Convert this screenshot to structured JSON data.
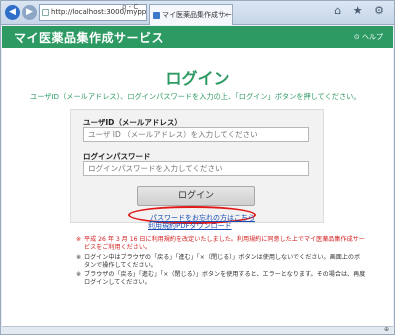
{
  "browser": {
    "address": "http://localhost:3000/myppe",
    "address_tools": "ρ - C",
    "tab_label": "マイ医薬品集作成サービ...",
    "tab_close": "×",
    "window_icons": "⌂ ★ ⚙"
  },
  "app": {
    "title": "マイ医薬品集作成サービス",
    "help": "⊙ ヘルプ"
  },
  "login": {
    "title": "ログイン",
    "instruction": "ユーザID（メールアドレス）、ログインパスワードを入力の上、「ログイン」ボタンを押してください。",
    "user_label": "ユーザID（メールアドレス）",
    "user_placeholder": "ユーザ ID （メールアドレス）を入力してください",
    "password_label": "ログインパスワード",
    "password_placeholder": "ログインパスワードを入力してください",
    "button": "ログイン",
    "forgot_link": "パスワードをお忘れの方はこちら",
    "terms_link": "利用規約PDFダウンロード"
  },
  "notes": [
    {
      "mark": "※",
      "text": "平成 26 年 3 月 16 日に利用規約を改定いたしました。利用規約に同意した上でマイ医薬品集作成サービスをご利用ください。"
    },
    {
      "mark": "※",
      "text": "ログイン中はブラウザの「戻る」「進む」「×（閉じる）」ボタンは使用しないでください。画面上のボタンで操作してください。"
    },
    {
      "mark": "※",
      "text": "ブラウザの「戻る」「進む」「×（閉じる）」ボタンを使用すると、エラーとなります。その場合は、再度ログインしてください。"
    }
  ],
  "status": {
    "zoom": "⊕"
  },
  "colors": {
    "brand": "#2e9a63",
    "link": "#1b4fb5",
    "warning": "#d21d1d",
    "highlight": "#e01818"
  }
}
